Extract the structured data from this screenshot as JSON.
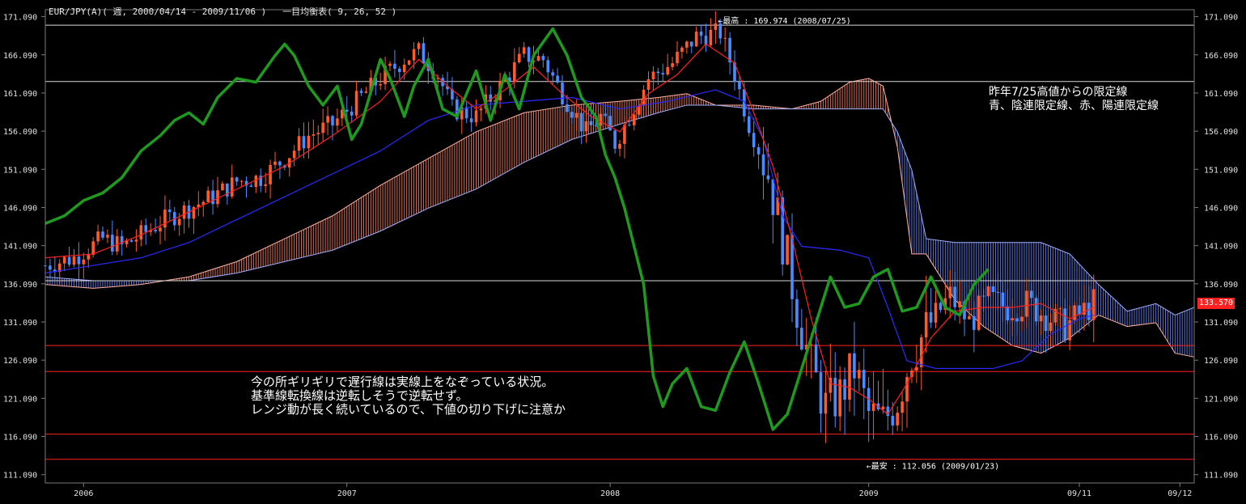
{
  "header": {
    "symbol_text": "EUR/JPY(A)( 週, 2000/04/14 - 2009/11/06 )",
    "indicator_text": "一目均衡表( 9, 26, 52 )"
  },
  "annotations": {
    "high_label": "←最高 : 169.974 (2008/07/25)",
    "low_label": "←最安 : 112.056 (2009/01/23)",
    "right_note": [
      "昨年7/25高値からの限定線",
      "青、陰連限定線、赤、陽連限定線"
    ],
    "main_note": [
      "今の所ギリギリで遅行線は実線上をなぞっている状況。",
      "基準線転換線は逆転しそうで逆転せず。",
      "レンジ動が長く続いているので、下値の切り下げに注意か"
    ],
    "current_price": "133.570"
  },
  "colors": {
    "background": "#000000",
    "frame": "#7a7a7a",
    "up_candle": "#ff5a2a",
    "down_candle": "#4a8cff",
    "tenkan": "#ff2020",
    "kijun": "#2a2aff",
    "chikou": "#1e9a1e",
    "kumo_red": "#ff8060",
    "kumo_blue": "#6a88ff",
    "h_line_white": "#d8d8d8",
    "h_line_red": "#ff2020",
    "price_tag": "#ff2020"
  },
  "chart_data": {
    "type": "candlestick-ichimoku",
    "title": "EUR/JPY(A)( 週, 2000/04/14 - 2009/11/06 )",
    "ylim": [
      110.0,
      172.0
    ],
    "y_ticks": [
      "171.090",
      "166.090",
      "161.090",
      "156.090",
      "151.090",
      "146.090",
      "141.090",
      "136.090",
      "131.090",
      "126.090",
      "121.090",
      "116.090",
      "111.090"
    ],
    "x_ticks": [
      "2006",
      "2007",
      "2008",
      "2009",
      "09/11",
      "09/12"
    ],
    "x_tick_weeks": [
      8,
      63,
      118,
      172,
      216,
      237
    ],
    "horizontal_lines": [
      {
        "value": 169.974,
        "color": "white"
      },
      {
        "value": 162.6,
        "color": "white"
      },
      {
        "value": 136.5,
        "color": "white"
      },
      {
        "value": 128.0,
        "color": "red"
      },
      {
        "value": 124.6,
        "color": "red"
      },
      {
        "value": 116.4,
        "color": "red"
      },
      {
        "value": 113.1,
        "color": "red"
      }
    ],
    "candle_trend": [
      [
        0,
        138.5
      ],
      [
        6,
        139.5
      ],
      [
        12,
        142.0
      ],
      [
        16,
        141.0
      ],
      [
        20,
        142.5
      ],
      [
        25,
        144.5
      ],
      [
        30,
        146.0
      ],
      [
        35,
        147.5
      ],
      [
        40,
        149.5
      ],
      [
        45,
        150.0
      ],
      [
        50,
        152.5
      ],
      [
        55,
        155.5
      ],
      [
        60,
        157.0
      ],
      [
        65,
        160.0
      ],
      [
        70,
        163.0
      ],
      [
        75,
        165.5
      ],
      [
        78,
        166.5
      ],
      [
        82,
        163.5
      ],
      [
        85,
        159.0
      ],
      [
        90,
        158.0
      ],
      [
        95,
        162.0
      ],
      [
        100,
        166.0
      ],
      [
        104,
        165.5
      ],
      [
        107,
        162.0
      ],
      [
        110,
        159.0
      ],
      [
        113,
        156.0
      ],
      [
        116,
        158.0
      ],
      [
        119,
        154.5
      ],
      [
        122,
        158.0
      ],
      [
        126,
        163.0
      ],
      [
        131,
        165.0
      ],
      [
        136,
        168.5
      ],
      [
        141,
        169.0
      ],
      [
        144,
        163.5
      ],
      [
        147,
        157.0
      ],
      [
        151,
        150.5
      ],
      [
        154,
        142.0
      ],
      [
        157,
        133.0
      ],
      [
        160,
        125.0
      ],
      [
        163,
        120.0
      ],
      [
        166,
        121.5
      ],
      [
        169,
        125.0
      ],
      [
        172,
        119.0
      ],
      [
        175,
        118.0
      ],
      [
        178,
        121.0
      ],
      [
        181,
        127.0
      ],
      [
        185,
        131.0
      ],
      [
        189,
        134.5
      ],
      [
        193,
        131.0
      ],
      [
        197,
        134.0
      ],
      [
        201,
        133.0
      ],
      [
        205,
        133.5
      ],
      [
        209,
        132.0
      ],
      [
        213,
        130.5
      ],
      [
        217,
        132.5
      ],
      [
        219,
        133.57
      ]
    ],
    "tenkan_points": [
      [
        0,
        139.5
      ],
      [
        10,
        140.0
      ],
      [
        20,
        142.5
      ],
      [
        30,
        145.5
      ],
      [
        40,
        148.5
      ],
      [
        50,
        151.5
      ],
      [
        60,
        155.5
      ],
      [
        70,
        160.0
      ],
      [
        78,
        165.5
      ],
      [
        84,
        162.0
      ],
      [
        90,
        159.0
      ],
      [
        96,
        161.5
      ],
      [
        102,
        164.5
      ],
      [
        108,
        161.0
      ],
      [
        114,
        158.0
      ],
      [
        120,
        156.0
      ],
      [
        126,
        161.0
      ],
      [
        132,
        163.5
      ],
      [
        138,
        167.5
      ],
      [
        144,
        165.0
      ],
      [
        148,
        158.5
      ],
      [
        152,
        151.5
      ],
      [
        156,
        142.0
      ],
      [
        160,
        131.5
      ],
      [
        164,
        123.0
      ],
      [
        168,
        122.5
      ],
      [
        172,
        121.0
      ],
      [
        176,
        119.0
      ],
      [
        180,
        123.0
      ],
      [
        185,
        129.0
      ],
      [
        190,
        132.5
      ],
      [
        196,
        133.0
      ],
      [
        202,
        133.0
      ],
      [
        208,
        133.5
      ],
      [
        214,
        131.5
      ],
      [
        219,
        133.0
      ]
    ],
    "kijun_points": [
      [
        0,
        137.5
      ],
      [
        10,
        138.5
      ],
      [
        20,
        139.5
      ],
      [
        30,
        141.5
      ],
      [
        40,
        144.5
      ],
      [
        50,
        147.5
      ],
      [
        60,
        150.5
      ],
      [
        70,
        153.5
      ],
      [
        80,
        157.5
      ],
      [
        90,
        159.5
      ],
      [
        100,
        160.0
      ],
      [
        110,
        160.5
      ],
      [
        120,
        159.0
      ],
      [
        130,
        160.0
      ],
      [
        140,
        161.5
      ],
      [
        146,
        160.0
      ],
      [
        150,
        155.0
      ],
      [
        154,
        145.0
      ],
      [
        158,
        141.0
      ],
      [
        166,
        140.5
      ],
      [
        172,
        139.5
      ],
      [
        176,
        133.0
      ],
      [
        180,
        126.0
      ],
      [
        186,
        125.0
      ],
      [
        192,
        125.0
      ],
      [
        198,
        125.0
      ],
      [
        204,
        126.0
      ],
      [
        210,
        129.5
      ],
      [
        216,
        131.5
      ],
      [
        219,
        132.0
      ]
    ],
    "chikou_points": [
      [
        0,
        144.0
      ],
      [
        4,
        145.0
      ],
      [
        8,
        147.0
      ],
      [
        12,
        148.0
      ],
      [
        16,
        150.0
      ],
      [
        20,
        153.5
      ],
      [
        24,
        155.5
      ],
      [
        27,
        157.5
      ],
      [
        30,
        158.5
      ],
      [
        33,
        157.0
      ],
      [
        36,
        160.5
      ],
      [
        40,
        163.0
      ],
      [
        44,
        162.5
      ],
      [
        48,
        166.0
      ],
      [
        50,
        167.5
      ],
      [
        52,
        166.0
      ],
      [
        55,
        162.0
      ],
      [
        58,
        159.5
      ],
      [
        61,
        162.0
      ],
      [
        64,
        155.0
      ],
      [
        66,
        157.0
      ],
      [
        70,
        165.5
      ],
      [
        72,
        163.0
      ],
      [
        75,
        158.0
      ],
      [
        77,
        162.0
      ],
      [
        80,
        165.5
      ],
      [
        83,
        159.0
      ],
      [
        86,
        158.0
      ],
      [
        90,
        164.0
      ],
      [
        93,
        157.5
      ],
      [
        96,
        163.5
      ],
      [
        99,
        159.0
      ],
      [
        102,
        166.0
      ],
      [
        106,
        169.5
      ],
      [
        109,
        166.0
      ],
      [
        112,
        160.5
      ],
      [
        115,
        158.0
      ],
      [
        117,
        153.0
      ],
      [
        119,
        150.0
      ],
      [
        121,
        146.0
      ],
      [
        123,
        141.0
      ],
      [
        125,
        136.0
      ],
      [
        127,
        124.0
      ],
      [
        129,
        120.0
      ],
      [
        131,
        123.0
      ],
      [
        134,
        125.0
      ],
      [
        137,
        120.0
      ],
      [
        140,
        119.5
      ],
      [
        143,
        124.5
      ],
      [
        146,
        128.5
      ],
      [
        149,
        123.0
      ],
      [
        152,
        117.0
      ],
      [
        155,
        119.0
      ],
      [
        158,
        125.0
      ],
      [
        161,
        131.0
      ],
      [
        164,
        137.0
      ],
      [
        167,
        133.0
      ],
      [
        170,
        133.5
      ],
      [
        173,
        137.0
      ],
      [
        176,
        138.0
      ],
      [
        179,
        132.5
      ],
      [
        182,
        133.0
      ],
      [
        185,
        137.0
      ],
      [
        188,
        133.0
      ],
      [
        191,
        132.0
      ],
      [
        194,
        136.0
      ],
      [
        197,
        138.0
      ]
    ],
    "kumo_points": [
      [
        0,
        136.0,
        137.0
      ],
      [
        10,
        135.5,
        136.5
      ],
      [
        20,
        136.0,
        136.5
      ],
      [
        30,
        137.0,
        136.5
      ],
      [
        40,
        139.0,
        137.5
      ],
      [
        50,
        142.0,
        139.0
      ],
      [
        60,
        145.0,
        140.5
      ],
      [
        70,
        149.0,
        143.0
      ],
      [
        80,
        152.5,
        146.0
      ],
      [
        90,
        156.0,
        148.5
      ],
      [
        100,
        158.5,
        152.0
      ],
      [
        110,
        159.5,
        155.0
      ],
      [
        120,
        160.0,
        157.0
      ],
      [
        128,
        160.5,
        158.5
      ],
      [
        134,
        161.0,
        159.5
      ],
      [
        140,
        159.5,
        159.5
      ],
      [
        148,
        159.5,
        159.0
      ],
      [
        156,
        159.0,
        159.0
      ],
      [
        162,
        160.0,
        159.0
      ],
      [
        168,
        162.5,
        159.0
      ],
      [
        172,
        163.0,
        159.0
      ],
      [
        175,
        162.0,
        159.0
      ],
      [
        178,
        154.0,
        156.0
      ],
      [
        181,
        140.0,
        151.0
      ],
      [
        184,
        140.0,
        142.0
      ],
      [
        190,
        134.0,
        141.5
      ],
      [
        196,
        130.5,
        141.5
      ],
      [
        202,
        128.0,
        141.5
      ],
      [
        208,
        127.0,
        141.5
      ],
      [
        214,
        129.0,
        140.0
      ],
      [
        220,
        132.0,
        136.0
      ],
      [
        226,
        130.5,
        132.5
      ],
      [
        232,
        131.0,
        133.5
      ],
      [
        236,
        127.0,
        132.0
      ],
      [
        240,
        126.5,
        133.0
      ]
    ],
    "extremes": {
      "high": {
        "value": 169.974,
        "date": "2008/07/25"
      },
      "low": {
        "value": 112.056,
        "date": "2009/01/23"
      }
    }
  }
}
